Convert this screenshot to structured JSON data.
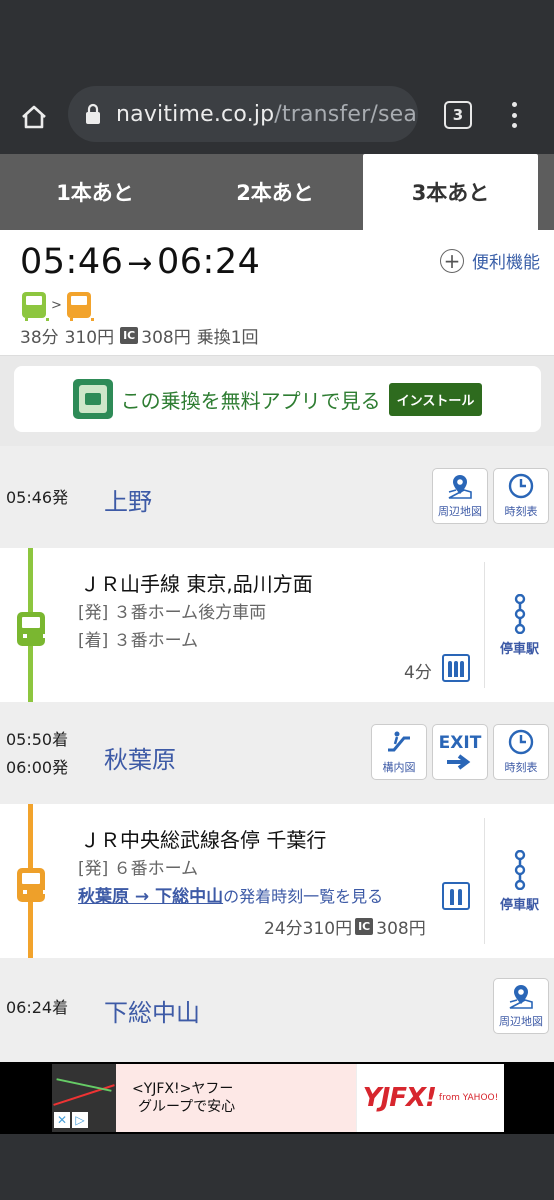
{
  "browser": {
    "url_domain": "navitime.co.jp",
    "url_path": "/transfer/searc",
    "tab_count": "3"
  },
  "tabs": [
    {
      "label": "1本あと"
    },
    {
      "label": "2本あと"
    },
    {
      "label": "3本あと",
      "active": true
    }
  ],
  "summary": {
    "depart": "05:46",
    "arrow": "→",
    "arrive": "06:24",
    "feature_label": "便利機能",
    "duration": "38分",
    "fare": "310円",
    "ic_label": "IC",
    "ic_fare": "308円",
    "transfers": "乗換1回"
  },
  "app_banner": {
    "text": "この乗換を無料アプリで見る",
    "install_label": "インストール"
  },
  "stations": [
    {
      "time1": "05:46発",
      "name": "上野",
      "buttons": [
        "周辺地図",
        "時刻表"
      ]
    },
    {
      "time1": "05:50着",
      "time2": "06:00発",
      "name": "秋葉原",
      "buttons": [
        "構内図",
        "EXIT",
        "時刻表"
      ]
    },
    {
      "time1": "06:24着",
      "name": "下総中山",
      "buttons": [
        "周辺地図"
      ]
    }
  ],
  "segments": [
    {
      "line_name": "ＪＲ山手線 東京,品川方面",
      "platform_dep": "[発] ３番ホーム後方車両",
      "platform_arr": "[着] ３番ホーム",
      "duration": "4分",
      "stops_label": "停車駅",
      "color": "#8dc63f"
    },
    {
      "line_name": "ＪＲ中央総武線各停 千葉行",
      "platform_dep": "[発] ６番ホーム",
      "timetable_link": "秋葉原 → 下総中山",
      "timetable_suffix": "の発着時刻一覧を見る",
      "duration": "24分",
      "fare": "310円",
      "ic_label": "IC",
      "ic_fare": "308円",
      "stops_label": "停車駅",
      "color": "#f2a32c"
    }
  ],
  "ad": {
    "line1": "<YJFX!>ヤフー",
    "line2": "グループで安心",
    "logo": "YJFX!",
    "logo_sub": "from YAHOO!"
  }
}
